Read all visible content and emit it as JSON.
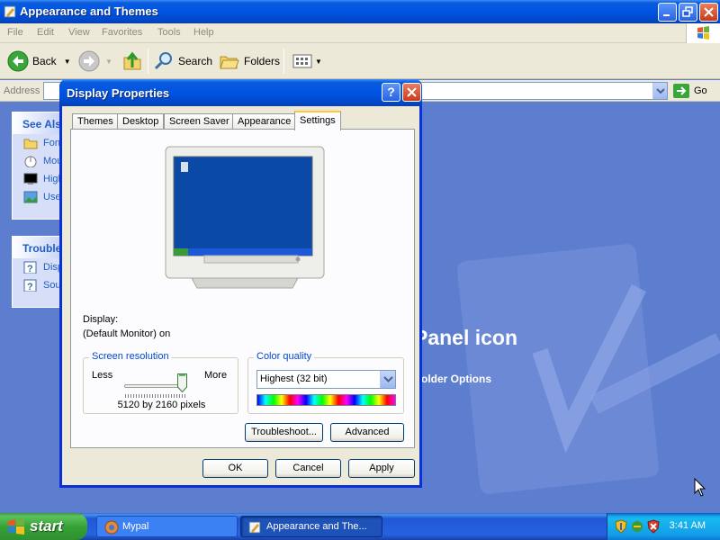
{
  "explorer": {
    "title": "Appearance and Themes",
    "menu": [
      "File",
      "Edit",
      "View",
      "Favorites",
      "Tools",
      "Help"
    ],
    "toolbar": {
      "back": "Back",
      "search": "Search",
      "folders": "Folders"
    },
    "address": {
      "label": "Address",
      "go": "Go"
    },
    "see_also": {
      "heading": "See Also",
      "items": [
        "Fonts",
        "Mouse Pointers",
        "High Contrast",
        "User Account Picture"
      ]
    },
    "troubleshooters": {
      "heading": "Troubleshooters",
      "items": [
        "Display",
        "Sound"
      ]
    },
    "pick_heading": "Panel icon",
    "pick_sub": "older Options"
  },
  "dialog": {
    "title": "Display Properties",
    "help_glyph": "?",
    "tabs": [
      "Themes",
      "Desktop",
      "Screen Saver",
      "Appearance",
      "Settings"
    ],
    "active_tab": "Settings",
    "display_label": "Display:",
    "display_value": "(Default Monitor) on",
    "resolution": {
      "legend": "Screen resolution",
      "less": "Less",
      "more": "More",
      "value": "5120 by 2160 pixels",
      "slider_level": 1.0
    },
    "color_quality": {
      "legend": "Color quality",
      "selected": "Highest (32 bit)"
    },
    "buttons": {
      "troubleshoot": "Troubleshoot...",
      "advanced": "Advanced",
      "ok": "OK",
      "cancel": "Cancel",
      "apply": "Apply"
    }
  },
  "taskbar": {
    "start": "start",
    "tasks": [
      "Mypal",
      "Appearance and The..."
    ],
    "clock": "3:41 AM"
  },
  "colors": {
    "xp_blue": "#0054e3",
    "task_link": "#215dc6",
    "group_legend": "#0046d5",
    "start_green": "#36a336"
  }
}
